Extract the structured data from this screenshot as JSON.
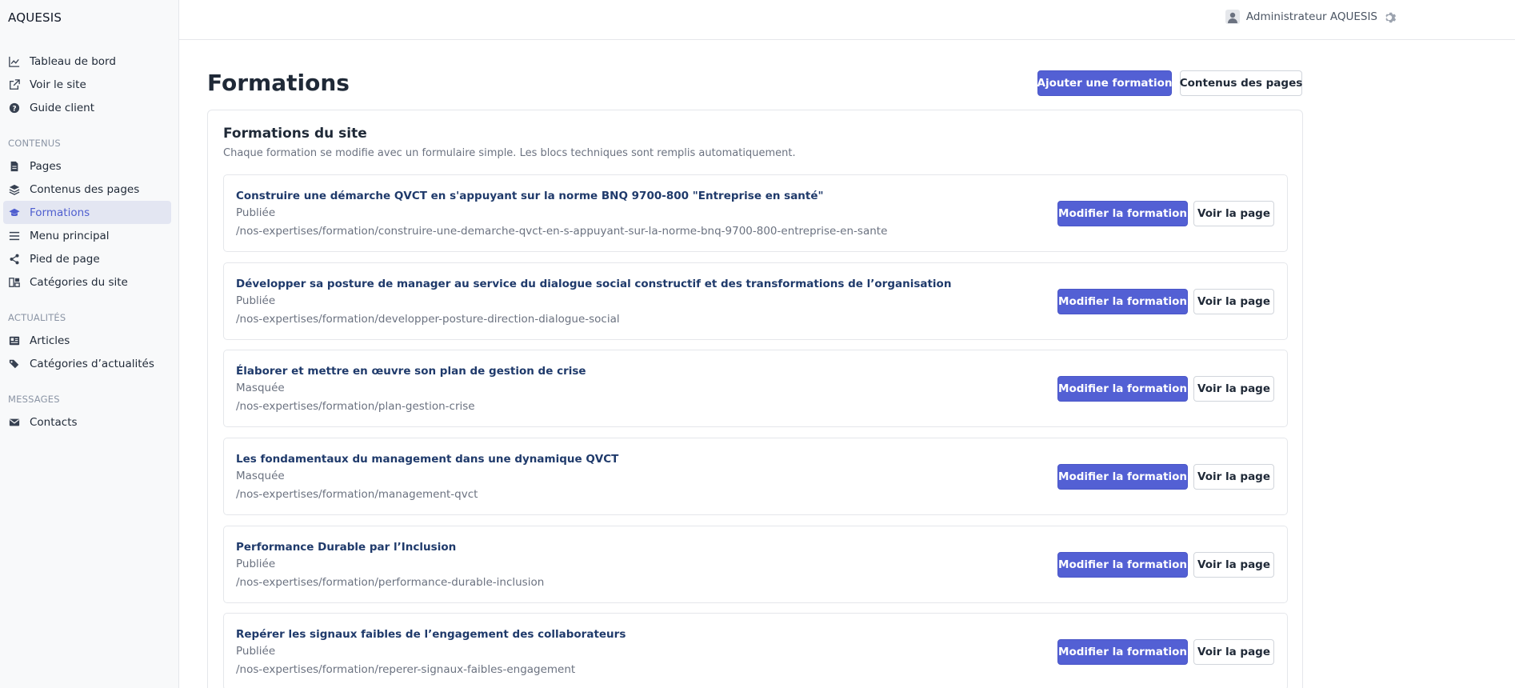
{
  "brand": "AQUESIS",
  "sidebar": {
    "items_top": [
      {
        "label": "Tableau de bord",
        "icon": "chart-line-icon"
      },
      {
        "label": "Voir le site",
        "icon": "external-link-icon"
      },
      {
        "label": "Guide client",
        "icon": "help-circle-icon"
      }
    ],
    "sections": [
      {
        "label": "CONTENUS",
        "items": [
          {
            "label": "Pages",
            "icon": "file-icon"
          },
          {
            "label": "Contenus des pages",
            "icon": "layers-icon"
          },
          {
            "label": "Formations",
            "icon": "graduation-cap-icon",
            "active": true
          },
          {
            "label": "Menu principal",
            "icon": "menu-icon"
          },
          {
            "label": "Pied de page",
            "icon": "share-icon"
          },
          {
            "label": "Catégories du site",
            "icon": "grid-icon"
          }
        ]
      },
      {
        "label": "ACTUALITÉS",
        "items": [
          {
            "label": "Articles",
            "icon": "newspaper-icon"
          },
          {
            "label": "Catégories d’actualités",
            "icon": "tags-icon"
          }
        ]
      },
      {
        "label": "MESSAGES",
        "items": [
          {
            "label": "Contacts",
            "icon": "envelope-icon"
          }
        ]
      }
    ]
  },
  "topbar": {
    "user": "Administrateur AQUESIS"
  },
  "main": {
    "title": "Formations",
    "add_button": "Ajouter une formation",
    "content_button": "Contenus des pages",
    "panel_title": "Formations du site",
    "panel_subtitle": "Chaque formation se modifie avec un formulaire simple. Les blocs techniques sont remplis automatiquement.",
    "edit_label": "Modifier la formation",
    "view_label": "Voir la page",
    "formations": [
      {
        "title": "Construire une démarche QVCT en s'appuyant sur la norme BNQ 9700-800 \"Entreprise en santé\"",
        "status": "Publiée",
        "url": "/nos-expertises/formation/construire-une-demarche-qvct-en-s-appuyant-sur-la-norme-bnq-9700-800-entreprise-en-sante"
      },
      {
        "title": "Développer sa posture de manager au service du dialogue social constructif et des transformations de l’organisation",
        "status": "Publiée",
        "url": "/nos-expertises/formation/developper-posture-direction-dialogue-social"
      },
      {
        "title": "Élaborer et mettre en œuvre son plan de gestion de crise",
        "status": "Masquée",
        "url": "/nos-expertises/formation/plan-gestion-crise"
      },
      {
        "title": "Les fondamentaux du management dans une dynamique QVCT",
        "status": "Masquée",
        "url": "/nos-expertises/formation/management-qvct"
      },
      {
        "title": "Performance Durable par l’Inclusion",
        "status": "Publiée",
        "url": "/nos-expertises/formation/performance-durable-inclusion"
      },
      {
        "title": "Repérer les signaux faibles de l’engagement des collaborateurs",
        "status": "Publiée",
        "url": "/nos-expertises/formation/reperer-signaux-faibles-engagement"
      }
    ]
  },
  "colors": {
    "accent": "#5360d4",
    "active_bg": "#e3e6f2",
    "title_link": "#1f3a6b"
  }
}
